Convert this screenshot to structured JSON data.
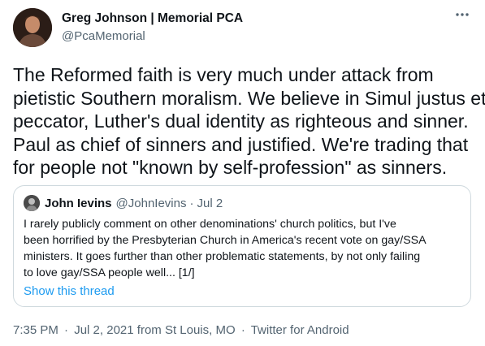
{
  "tweet": {
    "author": {
      "name": "Greg Johnson | Memorial PCA",
      "handle": "@PcaMemorial"
    },
    "more_icon": "more-horizontal-icon",
    "text_lines": [
      "The Reformed faith is very much under attack from",
      "pietistic Southern moralism. We believe in Simul justus et",
      "peccator, Luther's dual identity as righteous and sinner.",
      "Paul as chief of sinners and justified. We're trading that",
      "for people not \"known by self-profession\" as sinners."
    ],
    "quote": {
      "name": "John Ievins",
      "handle": "@JohnIevins",
      "separator": "·",
      "date": "Jul 2",
      "text_lines": [
        "I rarely publicly comment on other denominations' church politics, but I've",
        "been horrified by the Presbyterian Church in America's recent vote on gay/SSA",
        "ministers. It goes further than other problematic statements, by not only failing",
        "to love gay/SSA people well... [1/]"
      ],
      "show_thread": "Show this thread"
    },
    "meta": {
      "time": "7:35 PM",
      "separator": "·",
      "date": "Jul 2, 2021 from St Louis, MO",
      "client": "Twitter for Android"
    }
  },
  "colors": {
    "text": "#0f1419",
    "secondary": "#536471",
    "link": "#1d9bf0",
    "border": "#cfd9de"
  }
}
